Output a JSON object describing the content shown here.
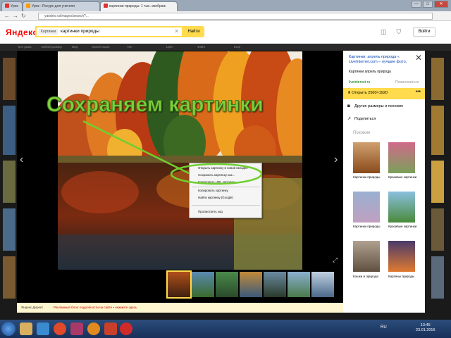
{
  "browser": {
    "tabs": [
      {
        "label": "Урок"
      },
      {
        "label": "Урок - Ресурс для учителя"
      },
      {
        "label": "картинки природы: 1 тыс. изображ"
      }
    ],
    "url": "yandex.ru/images/search?...",
    "window_buttons": {
      "minimize": "—",
      "maximize": "□",
      "close": "✕"
    }
  },
  "header": {
    "logo": "Яндекс",
    "search_chip": "Картинки",
    "query": "картинки природы",
    "search_button": "Найти",
    "login": "Войти"
  },
  "menu": [
    "все разм.",
    "любой размер",
    "Вид",
    "Ориентация",
    "Тип",
    "Цвет",
    "Файл",
    "Ещё"
  ],
  "caption": "Сохраняем картинки",
  "sidebar": {
    "title": "Картинки: апрель природа « LiveInternet.com – лучшие фото,",
    "description": "Картинки апрель природа",
    "source": "liveinternet.ru",
    "source2": "Пожаловаться",
    "download": "Открыть 2560×1920",
    "dots": "•••",
    "other_sizes": "Другие размеры и похожие",
    "share": "Поделиться",
    "similar_heading": "Похожие",
    "similar": [
      {
        "label": "Картинки природы"
      },
      {
        "label": "Красивые картинки"
      },
      {
        "label": "Картинки природы"
      },
      {
        "label": "Красивые картинки"
      },
      {
        "label": "Кошки и природа"
      },
      {
        "label": "Картины природы"
      }
    ]
  },
  "context_menu": [
    "Открыть картинку в новой вкладке",
    "Сохранить картинку как...",
    "Копировать URL картинки",
    "Копировать картинку",
    "Найти картинку (Google)",
    "Просмотреть код"
  ],
  "infobar": {
    "left": "Яндекс.Директ",
    "text": "Рекламный блок: подробности на сайте • нажмите здесь"
  },
  "taskbar": {
    "lang": "RU",
    "time": "13:45",
    "date": "23.01.2016"
  }
}
